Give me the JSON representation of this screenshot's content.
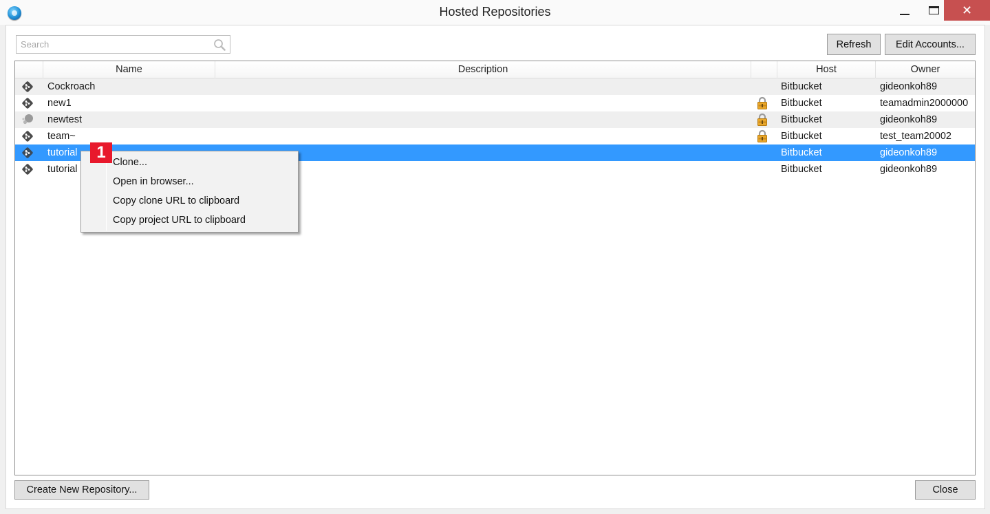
{
  "window": {
    "title": "Hosted Repositories",
    "controls": {
      "minimize": "minimize",
      "maximize": "maximize",
      "close": "✕"
    }
  },
  "search": {
    "placeholder": "Search",
    "value": ""
  },
  "toolbar": {
    "refresh_label": "Refresh",
    "edit_accounts_label": "Edit Accounts..."
  },
  "table": {
    "columns": [
      "",
      "Name",
      "Description",
      "",
      "Host",
      "Owner"
    ],
    "rows": [
      {
        "type": "git",
        "name": "Cockroach",
        "description": "",
        "private": false,
        "host": "Bitbucket",
        "owner": "gideonkoh89"
      },
      {
        "type": "git",
        "name": "new1",
        "description": "",
        "private": true,
        "host": "Bitbucket",
        "owner": "teamadmin2000000"
      },
      {
        "type": "hg",
        "name": "newtest",
        "description": "",
        "private": true,
        "host": "Bitbucket",
        "owner": "gideonkoh89"
      },
      {
        "type": "git",
        "name": "team~",
        "description": "",
        "private": true,
        "host": "Bitbucket",
        "owner": "test_team20002"
      },
      {
        "type": "git",
        "name": "tutorial",
        "description": "",
        "private": false,
        "host": "Bitbucket",
        "owner": "gideonkoh89",
        "selected": true
      },
      {
        "type": "git",
        "name": "tutorial",
        "description": "",
        "private": false,
        "host": "Bitbucket",
        "owner": "gideonkoh89"
      }
    ]
  },
  "context_menu": {
    "items": [
      "Clone...",
      "Open in browser...",
      "Copy clone URL to clipboard",
      "Copy project URL to clipboard"
    ]
  },
  "callout": {
    "label": "1",
    "color": "#e8192c"
  },
  "footer": {
    "create_label": "Create New Repository...",
    "close_label": "Close"
  },
  "colors": {
    "selection": "#3399ff",
    "close_button": "#c75050",
    "alt_row": "#efefef"
  }
}
